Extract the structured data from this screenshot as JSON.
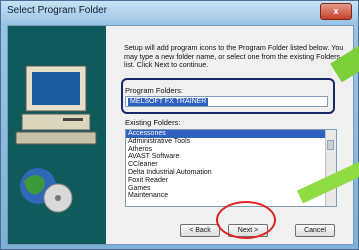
{
  "window": {
    "title": "Select Program Folder",
    "close": "x"
  },
  "description": "Setup will add program icons to the Program Folder listed below. You may type a new folder name, or select one from the existing Folders list. Click Next to continue.",
  "program_folders": {
    "label": "Program Folders:",
    "value": "MELSOFT FX TRAINER"
  },
  "existing_folders": {
    "label": "Existing Folders:",
    "items": [
      "Accessories",
      "Administrative Tools",
      "Atheros",
      "AVAST Software",
      "CCleaner",
      "Delta Industrial Automation",
      "Foxit Reader",
      "Games",
      "Maintenance"
    ]
  },
  "buttons": {
    "back": "< Back",
    "next": "Next >",
    "cancel": "Cancel"
  },
  "colors": {
    "selection": "#3060c0",
    "callout_circle": "#d22222",
    "arrow": "#7ed03a"
  }
}
